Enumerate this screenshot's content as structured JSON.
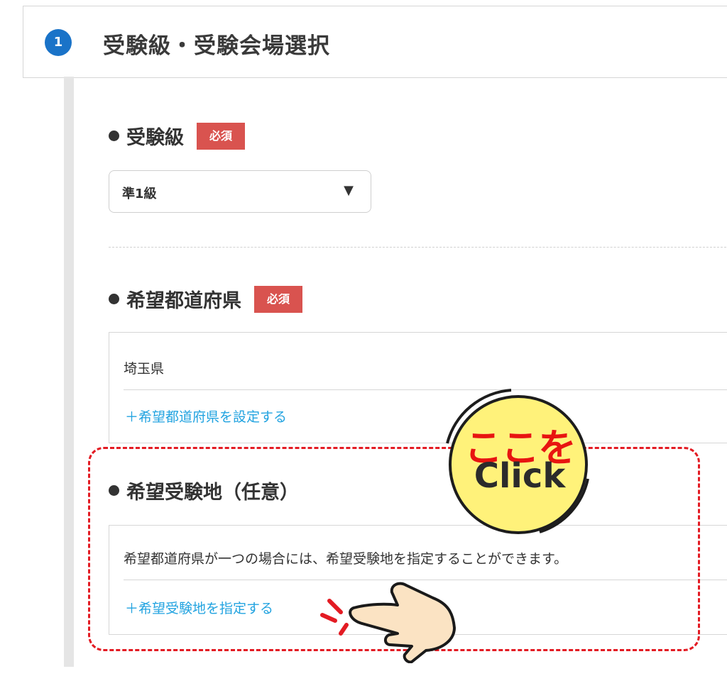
{
  "header": {
    "step_number": "1",
    "title": "受験級・受験会場選択"
  },
  "grade_section": {
    "label": "受験級",
    "required_badge": "必須",
    "select": {
      "value": "準1級",
      "arrow": "▼"
    }
  },
  "prefecture_section": {
    "label": "希望都道府県",
    "required_badge": "必須",
    "selected_value": "埼玉県",
    "add_link": "＋希望都道府県を設定する"
  },
  "venue_section": {
    "label": "希望受験地（任意）",
    "note": "希望都道府県が一つの場合には、希望受験地を指定することができます。",
    "add_link": "＋希望受験地を指定する"
  },
  "callout": {
    "top_text": "ここを",
    "bottom_text": "Click"
  },
  "colors": {
    "accent_blue": "#1a73c8",
    "required_red": "#d9534f",
    "link_blue": "#22a3e0",
    "highlight_red": "#e31b23",
    "callout_yellow": "#fff27a"
  },
  "icons": [
    "step-number-circle",
    "bullet-dot",
    "dropdown-arrow-icon",
    "pointing-hand-icon"
  ]
}
